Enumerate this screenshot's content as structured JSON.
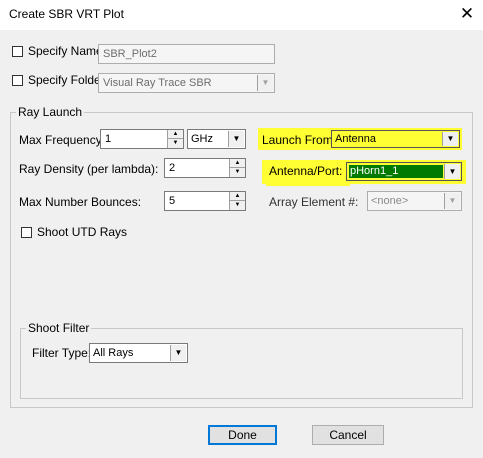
{
  "window": {
    "title": "Create SBR VRT Plot",
    "close_glyph": "✕"
  },
  "specify_name": {
    "label": "Specify Name",
    "value": "SBR_Plot2",
    "checked": false
  },
  "specify_folder": {
    "label": "Specify Folder",
    "value": "Visual Ray Trace SBR",
    "checked": false
  },
  "ray_launch": {
    "group_label": "Ray Launch",
    "max_frequency": {
      "label": "Max Frequency:",
      "value": "1",
      "unit": "GHz"
    },
    "ray_density": {
      "label": "Ray Density (per lambda):",
      "value": "2"
    },
    "max_bounces": {
      "label": "Max Number Bounces:",
      "value": "5"
    },
    "shoot_utd": {
      "label": "Shoot UTD Rays",
      "checked": false
    },
    "launch_from": {
      "label": "Launch From:",
      "value": "Antenna"
    },
    "antenna_port": {
      "label": "Antenna/Port:",
      "value": "pHorn1_1"
    },
    "array_element": {
      "label": "Array Element #:",
      "value": "<none>"
    }
  },
  "shoot_filter": {
    "group_label": "Shoot Filter",
    "filter_type": {
      "label": "Filter Type:",
      "value": "All Rays"
    }
  },
  "buttons": {
    "done": "Done",
    "cancel": "Cancel"
  },
  "colors": {
    "highlight": "#ffff33",
    "selected_port_bg": "#007a00",
    "dialog_bg": "#f0f0f0"
  },
  "icons": {
    "dropdown": "chevron-down-icon",
    "spinner": "spinner-arrows-icon",
    "close": "close-icon"
  }
}
